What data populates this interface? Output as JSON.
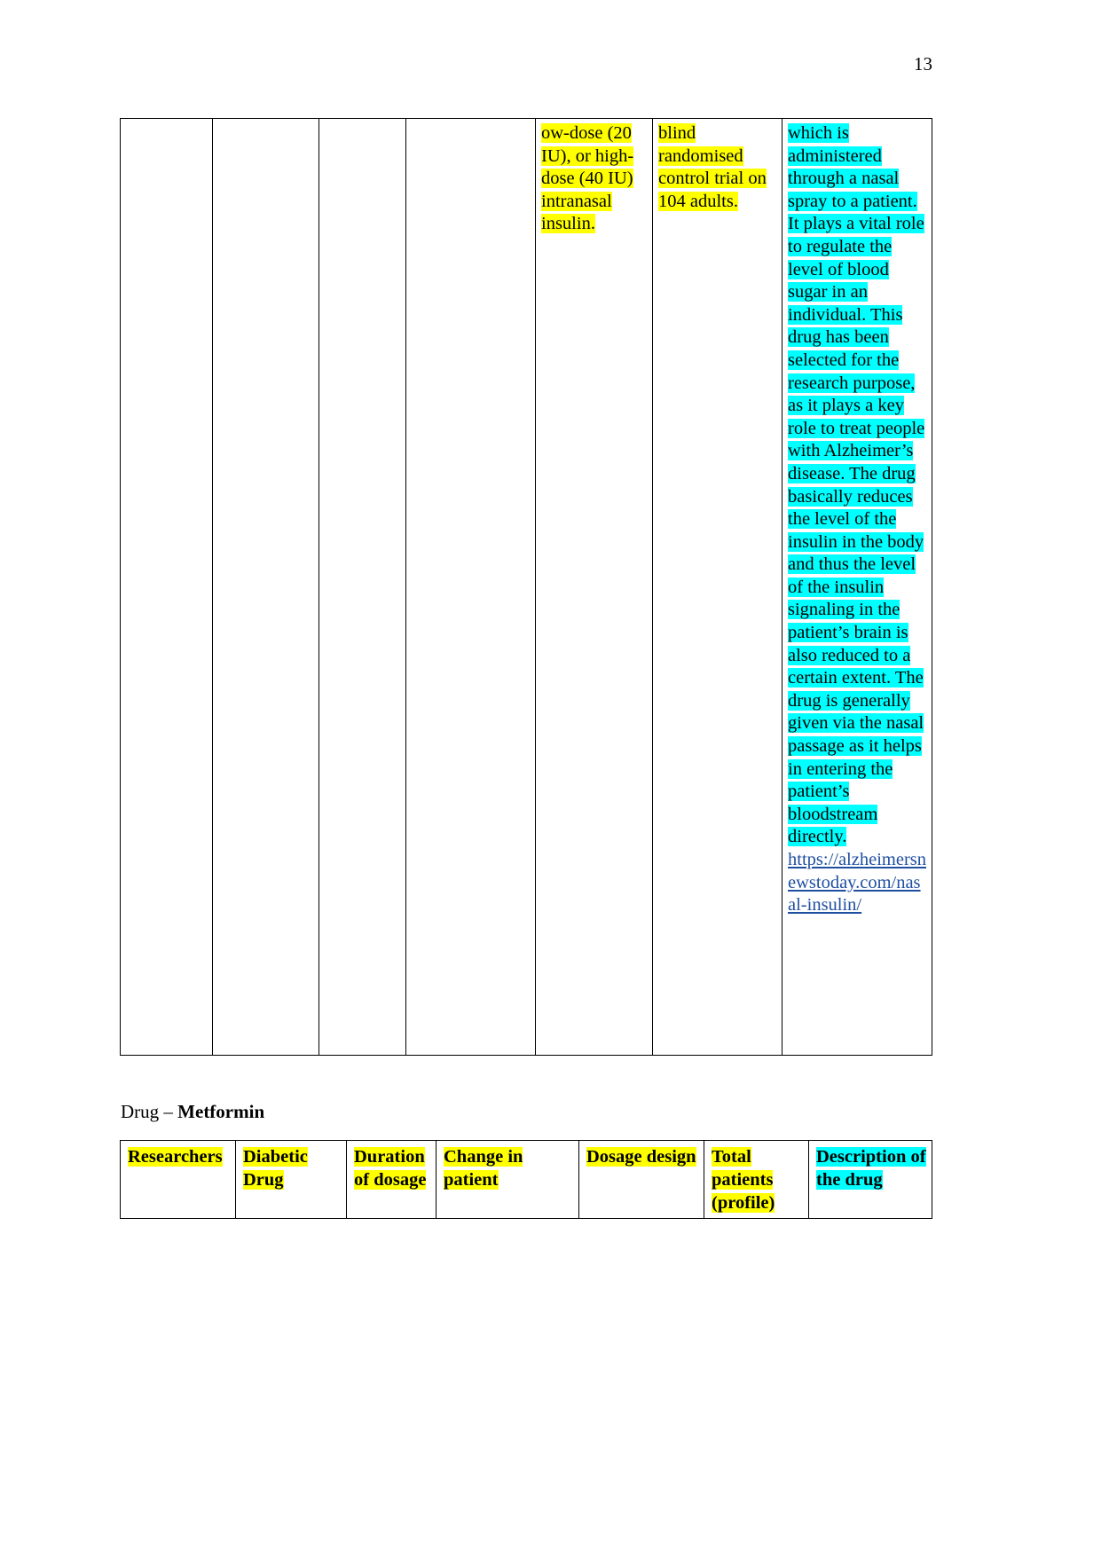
{
  "document": {
    "page_number": "13",
    "caption_prefix": "Drug – ",
    "caption_drug": "Metformin"
  },
  "colors": {
    "highlight_yellow": "#ffff00",
    "highlight_cyan": "#00ffff",
    "link": "#1f4fa0",
    "text": "#000000",
    "border": "#000000",
    "page_background": "#ffffff"
  },
  "continued_table": {
    "columns": [
      {
        "id": "researchers",
        "content": ""
      },
      {
        "id": "diabetic-drug",
        "content": ""
      },
      {
        "id": "duration-of-dosage",
        "content": ""
      },
      {
        "id": "change-in-patient",
        "content": ""
      },
      {
        "id": "dosage-design",
        "content": "ow-dose (20 IU), or high-dose (40 IU) intranasal insulin."
      },
      {
        "id": "total-patients",
        "content": "blind randomised control trial on 104 adults."
      },
      {
        "id": "description-of-the-drug",
        "content": "which is administered through a nasal spray to a patient. It plays a vital role to regulate the level of blood sugar in an individual. This drug has been selected for the research purpose, as it plays a key role to treat people with Alzheimer’s disease. The drug basically reduces the level of the insulin in the body and thus the level of the insulin signaling in the patient’s brain is also reduced to a certain extent. The drug is generally given via the nasal passage as it helps in entering the patient’s bloodstream directly."
      }
    ],
    "description_link": "https://alzheimersnewstoday.com/nasal-insulin/"
  },
  "metformin_table": {
    "headers": [
      {
        "id": "researchers",
        "label": "Researchers",
        "highlight": "yellow"
      },
      {
        "id": "diabetic-drug",
        "label": "Diabetic Drug",
        "highlight": "yellow"
      },
      {
        "id": "duration-of-dosage",
        "label": "Duration of dosage",
        "highlight": "yellow"
      },
      {
        "id": "change-in-patient",
        "label": "Change in patient",
        "highlight": "yellow"
      },
      {
        "id": "dosage-design",
        "label": "Dosage design",
        "highlight": "yellow"
      },
      {
        "id": "total-patients",
        "label": "Total patients (profile)",
        "highlight": "yellow"
      },
      {
        "id": "description-of-the-drug",
        "label": "Description of the drug",
        "highlight": "cyan"
      }
    ]
  }
}
